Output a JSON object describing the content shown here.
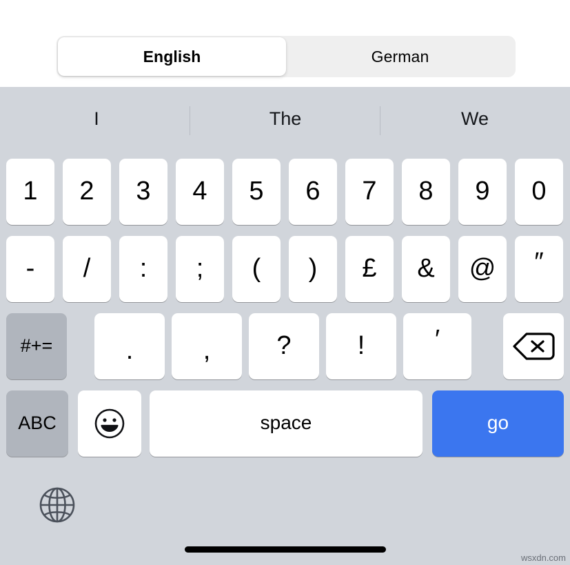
{
  "language_selector": {
    "options": [
      "English",
      "German"
    ],
    "selected": "English",
    "selected_index": 0
  },
  "suggestion_bar": {
    "suggestions": [
      "I",
      "The",
      "We"
    ]
  },
  "keyboard": {
    "layout_name": "numbers-and-symbols",
    "rows": {
      "numbers": [
        {
          "label": "1",
          "name": "key-1",
          "type": "char"
        },
        {
          "label": "2",
          "name": "key-2",
          "type": "char"
        },
        {
          "label": "3",
          "name": "key-3",
          "type": "char"
        },
        {
          "label": "4",
          "name": "key-4",
          "type": "char"
        },
        {
          "label": "5",
          "name": "key-5",
          "type": "char"
        },
        {
          "label": "6",
          "name": "key-6",
          "type": "char"
        },
        {
          "label": "7",
          "name": "key-7",
          "type": "char"
        },
        {
          "label": "8",
          "name": "key-8",
          "type": "char"
        },
        {
          "label": "9",
          "name": "key-9",
          "type": "char"
        },
        {
          "label": "0",
          "name": "key-0",
          "type": "char"
        }
      ],
      "symbols": [
        {
          "label": "-",
          "name": "key-hyphen",
          "type": "char"
        },
        {
          "label": "/",
          "name": "key-slash",
          "type": "char"
        },
        {
          "label": ":",
          "name": "key-colon",
          "type": "char"
        },
        {
          "label": ";",
          "name": "key-semicolon",
          "type": "char"
        },
        {
          "label": "(",
          "name": "key-left-paren",
          "type": "char"
        },
        {
          "label": ")",
          "name": "key-right-paren",
          "type": "char"
        },
        {
          "label": "£",
          "name": "key-pound-sign",
          "type": "char"
        },
        {
          "label": "&",
          "name": "key-ampersand",
          "type": "char"
        },
        {
          "label": "@",
          "name": "key-at-sign",
          "type": "char"
        },
        {
          "label": "″",
          "name": "key-double-quote",
          "type": "char"
        }
      ],
      "third": [
        {
          "label": "#+=",
          "name": "key-symbols-toggle",
          "type": "modifier"
        },
        {
          "label": ".",
          "name": "key-period",
          "type": "char"
        },
        {
          "label": ",",
          "name": "key-comma",
          "type": "char"
        },
        {
          "label": "?",
          "name": "key-question-mark",
          "type": "char"
        },
        {
          "label": "!",
          "name": "key-exclamation-mark",
          "type": "char"
        },
        {
          "label": "′",
          "name": "key-apostrophe",
          "type": "char"
        },
        {
          "label": "",
          "name": "key-backspace",
          "type": "icon"
        }
      ],
      "bottom": [
        {
          "label": "ABC",
          "name": "key-abc-letters",
          "type": "modifier"
        },
        {
          "label": "",
          "name": "key-emoji",
          "type": "icon"
        },
        {
          "label": "space",
          "name": "key-space",
          "type": "space"
        },
        {
          "label": "go",
          "name": "key-go",
          "type": "action"
        }
      ]
    },
    "globe_key": {
      "name": "globe-icon",
      "label": ""
    }
  },
  "colors": {
    "keyboard_background": "#d1d5db",
    "key_background": "#ffffff",
    "modifier_key_background": "#b0b5bd",
    "action_key_background": "#3b76ef",
    "segmented_track": "#efefef"
  },
  "watermark": {
    "text": "wsxdn.com"
  }
}
